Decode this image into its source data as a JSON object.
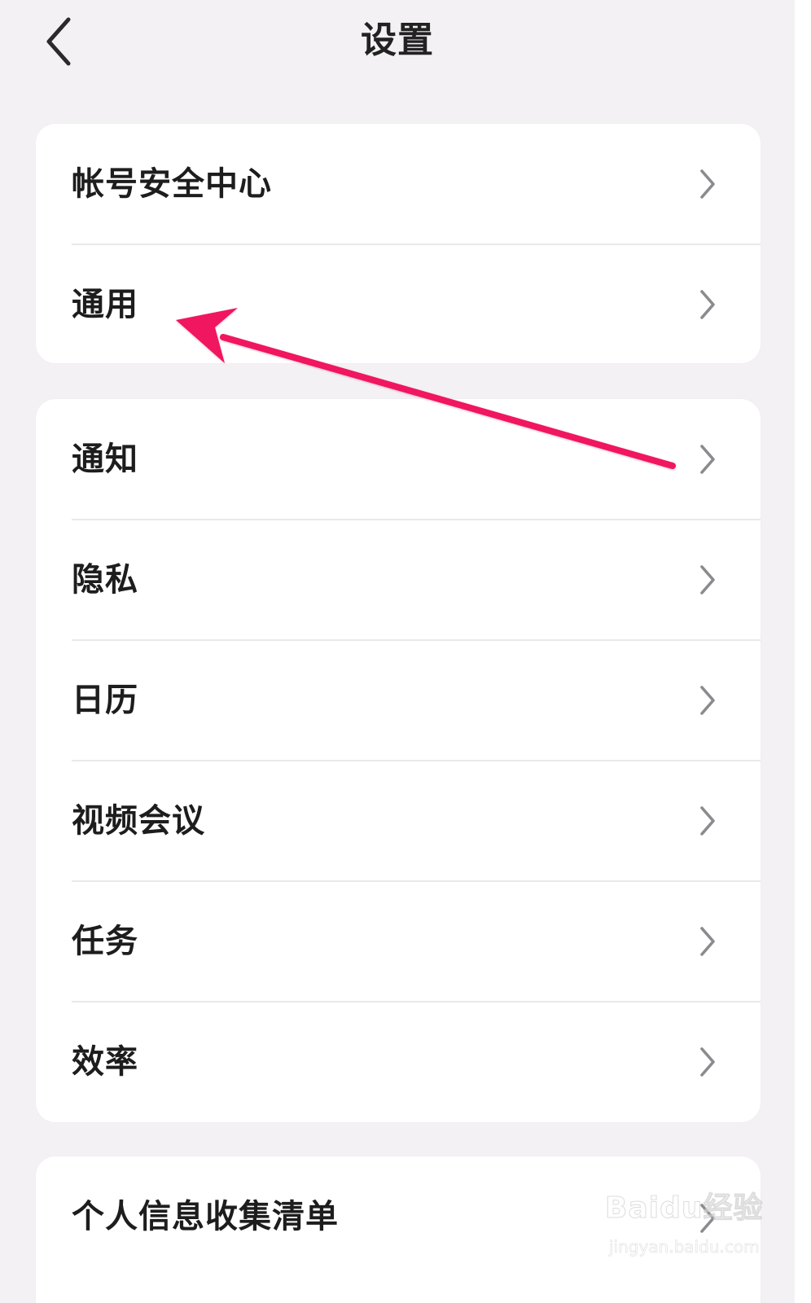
{
  "header": {
    "title": "设置",
    "back_icon": "chevron-left-icon"
  },
  "groups": [
    {
      "items": [
        {
          "label": "帐号安全中心",
          "icon": "chevron-right-icon"
        },
        {
          "label": "通用",
          "icon": "chevron-right-icon"
        }
      ]
    },
    {
      "items": [
        {
          "label": "通知",
          "icon": "chevron-right-icon"
        },
        {
          "label": "隐私",
          "icon": "chevron-right-icon"
        },
        {
          "label": "日历",
          "icon": "chevron-right-icon"
        },
        {
          "label": "视频会议",
          "icon": "chevron-right-icon"
        },
        {
          "label": "任务",
          "icon": "chevron-right-icon"
        },
        {
          "label": "效率",
          "icon": "chevron-right-icon"
        }
      ]
    },
    {
      "items": [
        {
          "label": "个人信息收集清单",
          "icon": "chevron-right-icon"
        }
      ]
    }
  ],
  "annotation": {
    "arrow_color": "#f0185f",
    "target": "通用"
  },
  "watermark": {
    "main_text": "Baidu经验",
    "sub_text": "jingyan.baidu.com"
  },
  "colors": {
    "background": "#f4f1f4",
    "card": "#ffffff",
    "text": "#1d1d1d",
    "divider": "#e9e9ec",
    "chevron": "#8a8a8f"
  }
}
